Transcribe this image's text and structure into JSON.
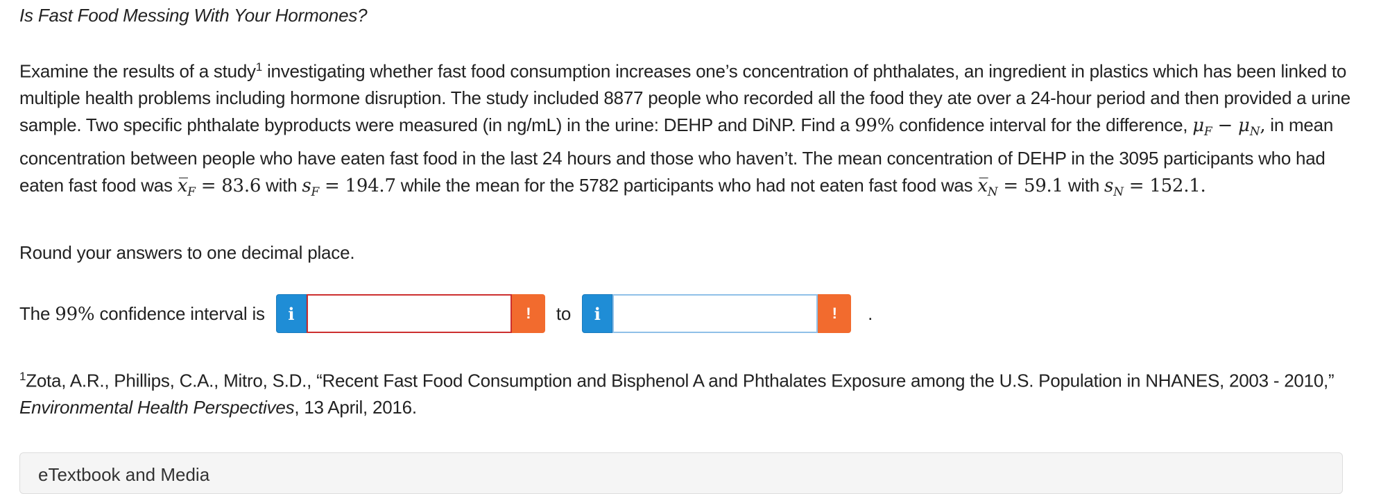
{
  "question": {
    "title": "Is Fast Food Messing With Your Hormones?",
    "paragraph": {
      "t1": "Examine the results of a study",
      "fn_marker": "1",
      "t2": " investigating whether fast food consumption increases one’s concentration of phthalates, an ingredient in plastics which has been linked to multiple health problems including hormone disruption. The study included 8877 people who recorded all the food they ate over a 24-hour period and then provided a urine sample. Two specific phthalate byproducts were measured (in ng/mL) in the urine: DEHP and DiNP. Find a ",
      "conf_level": "99%",
      "t3": " confidence interval for the difference, ",
      "mu_f": "μ",
      "sub_f": "F",
      "minus": " − ",
      "mu_n": "μ",
      "sub_n": "N",
      "comma": ",",
      "t4": " in mean concentration between people who have eaten fast food in the last 24 hours and those who haven’t. The mean concentration of DEHP in the 3095 participants who had eaten fast food was ",
      "xbar_f_sym": "x̅",
      "xbar_f_sub": "F",
      "xbar_f_val": " = 83.6",
      "t5": " with ",
      "s_f_sym": "s",
      "s_f_sub": "F",
      "s_f_val": " = 194.7",
      "t6": " while the mean for the 5782 participants who had not eaten fast food was ",
      "xbar_n_sym": "x̅",
      "xbar_n_sub": "N",
      "xbar_n_val": " = 59.1",
      "t7": " with ",
      "s_n_sym": "s",
      "s_n_sub": "N",
      "s_n_val": " = 152.1",
      "t8": "."
    },
    "round_instruction": "Round your answers to one decimal place."
  },
  "answer": {
    "label_prefix": "The ",
    "label_level": "99%",
    "label_suffix": " confidence interval is",
    "info_icon": "i",
    "warn_icon": "!",
    "to_label": "to",
    "lower_value": "",
    "upper_value": "",
    "period": "."
  },
  "footnote": {
    "marker": "1",
    "text1": "Zota, A.R., Phillips, C.A., Mitro, S.D., “Recent Fast Food Consumption and Bisphenol A and Phthalates Exposure among the U.S. Population in NHANES, 2003 - 2010,” ",
    "journal": "Environmental Health Perspectives",
    "text2": ", 13 April, 2016."
  },
  "etextbook": {
    "title": "eTextbook and Media"
  },
  "colors": {
    "info_blue": "#1f8dd6",
    "warn_orange": "#f26b2e",
    "error_red": "#cc2f2f"
  }
}
